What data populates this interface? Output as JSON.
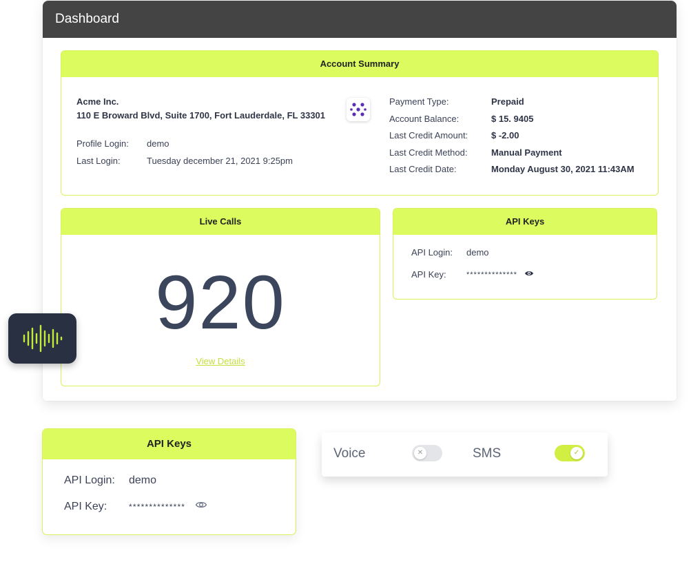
{
  "window": {
    "title": "Dashboard"
  },
  "account_summary": {
    "heading": "Account Summary",
    "company": "Acme Inc.",
    "address": "110 E Broward Blvd, Suite 1700, Fort Lauderdale, FL 33301",
    "profile_login_label": "Profile Login:",
    "profile_login_value": "demo",
    "last_login_label": "Last Login:",
    "last_login_value": "Tuesday december 21, 2021 9:25pm",
    "right": [
      {
        "label": "Payment Type:",
        "value": "Prepaid"
      },
      {
        "label": "Account Balance:",
        "value": "$ 15. 9405"
      },
      {
        "label": "Last Credit Amount:",
        "value": "$ -2.00"
      },
      {
        "label": "Last Credit Method:",
        "value": "Manual Payment"
      },
      {
        "label": "Last Credit Date:",
        "value": "Monday August 30, 2021 11:43AM"
      }
    ]
  },
  "live_calls": {
    "heading": "Live Calls",
    "count": "920",
    "link": "View Details"
  },
  "api_keys": {
    "heading": "API Keys",
    "login_label": "API Login:",
    "login_value": "demo",
    "key_label": "API Key:",
    "key_value": "**************"
  },
  "api_keys_floating": {
    "heading": "API Keys",
    "login_label": "API Login:",
    "login_value": "demo",
    "key_label": "API Key:",
    "key_value": "**************"
  },
  "toggles": {
    "voice_label": "Voice",
    "voice_on": false,
    "sms_label": "SMS",
    "sms_on": true
  },
  "colors": {
    "accent": "#dcfb5e",
    "titlebar": "#444444",
    "text": "#3b4256",
    "badge_bg": "#283041",
    "logo_purple": "#5a2fb3"
  },
  "icons": {
    "logo": "dots-logo-icon",
    "wave": "sound-wave-icon",
    "eye": "eye-icon",
    "toggle_off": "x-icon",
    "toggle_on": "check-icon"
  }
}
